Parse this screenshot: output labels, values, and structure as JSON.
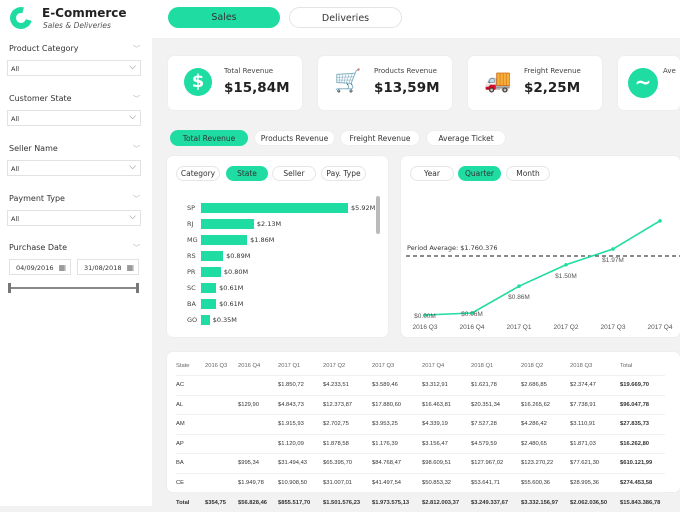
{
  "app": {
    "title": "E-Commerce",
    "subtitle": "Sales & Deliveries",
    "logo_icon": "swirl-logo-icon",
    "accent": "#1fdca2"
  },
  "tabs": [
    {
      "label": "Sales",
      "active": true
    },
    {
      "label": "Deliveries",
      "active": false
    }
  ],
  "filters": [
    {
      "label": "Product Category",
      "value": "All"
    },
    {
      "label": "Customer State",
      "value": "All"
    },
    {
      "label": "Seller Name",
      "value": "All"
    },
    {
      "label": "Payment Type",
      "value": "All"
    }
  ],
  "date_filter": {
    "label": "Purchase Date",
    "start": "04/09/2016",
    "end": "31/08/2018"
  },
  "kpis": [
    {
      "label": "Total Revenue",
      "value": "$15,84M",
      "icon": "dollar-icon"
    },
    {
      "label": "Products Revenue",
      "value": "$13,59M",
      "icon": "cart-icon"
    },
    {
      "label": "Freight Revenue",
      "value": "$2,25M",
      "icon": "truck-icon"
    },
    {
      "label": "Ave",
      "value": "",
      "icon": "wave-icon"
    }
  ],
  "metric_pills": [
    {
      "label": "Total Revenue",
      "active": true
    },
    {
      "label": "Products Revenue"
    },
    {
      "label": "Freight Revenue"
    },
    {
      "label": "Average Ticket"
    }
  ],
  "bar_tabs": [
    {
      "label": "Category"
    },
    {
      "label": "State",
      "active": true
    },
    {
      "label": "Seller"
    },
    {
      "label": "Pay. Type"
    }
  ],
  "time_tabs": [
    {
      "label": "Year"
    },
    {
      "label": "Quarter",
      "active": true
    },
    {
      "label": "Month"
    }
  ],
  "chart_data": [
    {
      "type": "bar",
      "orientation": "horizontal",
      "categories": [
        "SP",
        "RJ",
        "MG",
        "RS",
        "PR",
        "SC",
        "BA",
        "GO"
      ],
      "values": [
        5.92,
        2.13,
        1.86,
        0.89,
        0.8,
        0.61,
        0.61,
        0.35
      ],
      "labels": [
        "$5.92M",
        "$2.13M",
        "$1.86M",
        "$0.89M",
        "$0.80M",
        "$0.61M",
        "$0.61M",
        "$0.35M"
      ],
      "unit": "$M"
    },
    {
      "type": "line",
      "categories": [
        "2016 Q3",
        "2016 Q4",
        "2017 Q1",
        "2017 Q2",
        "2017 Q3",
        "2017 Q4"
      ],
      "values": [
        0.0,
        0.06,
        0.86,
        1.5,
        1.97,
        2.81
      ],
      "labels": [
        "$0.00M",
        "$0.06M",
        "$0.86M",
        "$1.50M",
        "$1.97M",
        ""
      ],
      "reference_line": {
        "label": "Period Average: $1.760.376",
        "value": 1.760376,
        "style": "dashed"
      },
      "color": "#1fdca2"
    }
  ],
  "table": {
    "headers": [
      "State",
      "2016 Q3",
      "2016 Q4",
      "2017 Q1",
      "2017 Q2",
      "2017 Q3",
      "2017 Q4",
      "2018 Q1",
      "2018 Q2",
      "2018 Q3",
      "Total"
    ],
    "rows": [
      [
        "AC",
        "",
        "",
        "$1.850,72",
        "$4.233,51",
        "$3.589,46",
        "$3.312,91",
        "$1.621,78",
        "$2.686,85",
        "$2.374,47",
        "$19.669,70"
      ],
      [
        "AL",
        "",
        "$129,90",
        "$4.843,73",
        "$12.373,87",
        "$17.880,60",
        "$16.463,81",
        "$20.351,34",
        "$16.265,62",
        "$7.738,91",
        "$96.047,78"
      ],
      [
        "AM",
        "",
        "",
        "$1.915,93",
        "$2.702,75",
        "$3.953,25",
        "$4.339,19",
        "$7.527,28",
        "$4.286,42",
        "$3.110,91",
        "$27.835,73"
      ],
      [
        "AP",
        "",
        "",
        "$1.120,09",
        "$1.878,58",
        "$1.176,39",
        "$3.156,47",
        "$4.579,59",
        "$2.480,65",
        "$1.871,03",
        "$16.262,80"
      ],
      [
        "BA",
        "",
        "$995,34",
        "$31.494,43",
        "$65.395,70",
        "$84.768,47",
        "$98.609,51",
        "$127.967,02",
        "$123.270,22",
        "$77.621,30",
        "$610.121,99"
      ],
      [
        "CE",
        "",
        "$1.949,78",
        "$10.908,50",
        "$31.007,01",
        "$41.497,54",
        "$50.853,32",
        "$53.641,71",
        "$55.600,36",
        "$28.995,36",
        "$274.453,58"
      ]
    ],
    "total": [
      "Total",
      "$354,75",
      "$56.828,46",
      "$855.517,70",
      "$1.501.576,23",
      "$1.973.575,13",
      "$2.812.003,37",
      "$3.249.337,67",
      "$3.332.156,97",
      "$2.062.036,50",
      "$15.843.386,78"
    ]
  }
}
